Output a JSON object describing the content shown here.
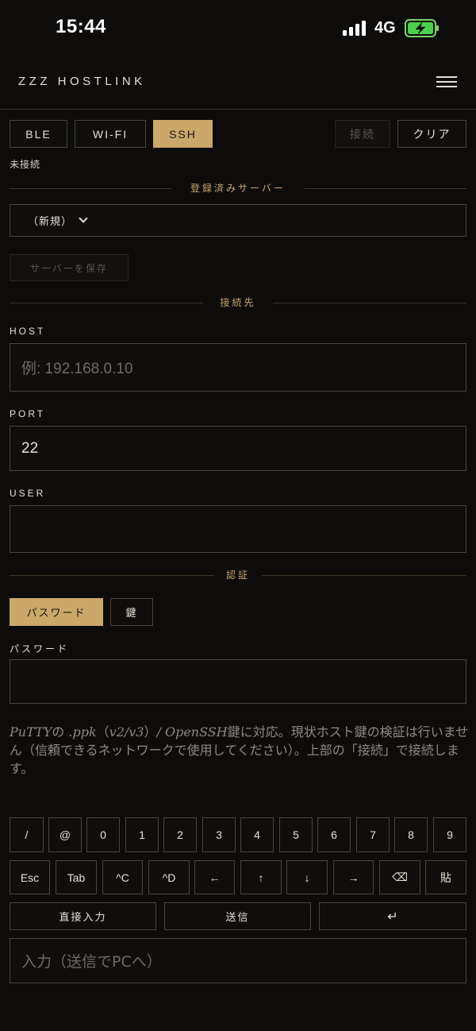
{
  "status_bar": {
    "time": "15:44",
    "network": "4G"
  },
  "header": {
    "title": "ZZZ HOSTLINK",
    "menu_icon": "hamburger-menu-icon"
  },
  "mode_tabs": {
    "ble": "BLE",
    "wifi": "WI-FI",
    "ssh": "SSH",
    "active": "SSH"
  },
  "actions": {
    "connect": "接続",
    "clear": "クリア"
  },
  "connection_state": "未接続",
  "saved_servers": {
    "heading": "登録済みサーバー",
    "selected": "（新規）",
    "save_button": "サーバーを保存"
  },
  "destination": {
    "heading": "接続先",
    "host_label": "HOST",
    "host_placeholder": "例: 192.168.0.10",
    "port_label": "PORT",
    "port_value": "22",
    "user_label": "USER",
    "user_value": ""
  },
  "auth": {
    "heading": "認証",
    "password_tab": "パスワード",
    "key_tab": "鍵",
    "active": "パスワード",
    "password_label": "パスワード",
    "password_value": ""
  },
  "note": {
    "putty": "PuTTY",
    "t1": "の ",
    "ppk": ".ppk",
    "t2": "（",
    "versions": "v2/v3",
    "t3": "）",
    "openssh": "/ OpenSSH",
    "t4": "鍵に対応。現状ホスト鍵の検証は行いません（信頼できるネットワークで使用してください）。上部の「接続」で接続します。"
  },
  "keyboard": {
    "row1": [
      "/",
      "@",
      "0",
      "1",
      "2",
      "3",
      "4",
      "5",
      "6",
      "7",
      "8",
      "9"
    ],
    "row2": [
      "Esc",
      "Tab",
      "^C",
      "^D",
      "←",
      "↑",
      "↓",
      "→",
      "⌫",
      "貼"
    ],
    "direct_input": "直接入力",
    "send": "送信",
    "enter": "↵"
  },
  "send_input": {
    "placeholder": "入力（送信でPCへ）"
  },
  "colors": {
    "accent": "#c9a86a",
    "background": "#0d0c0b",
    "border": "#4a4338"
  }
}
